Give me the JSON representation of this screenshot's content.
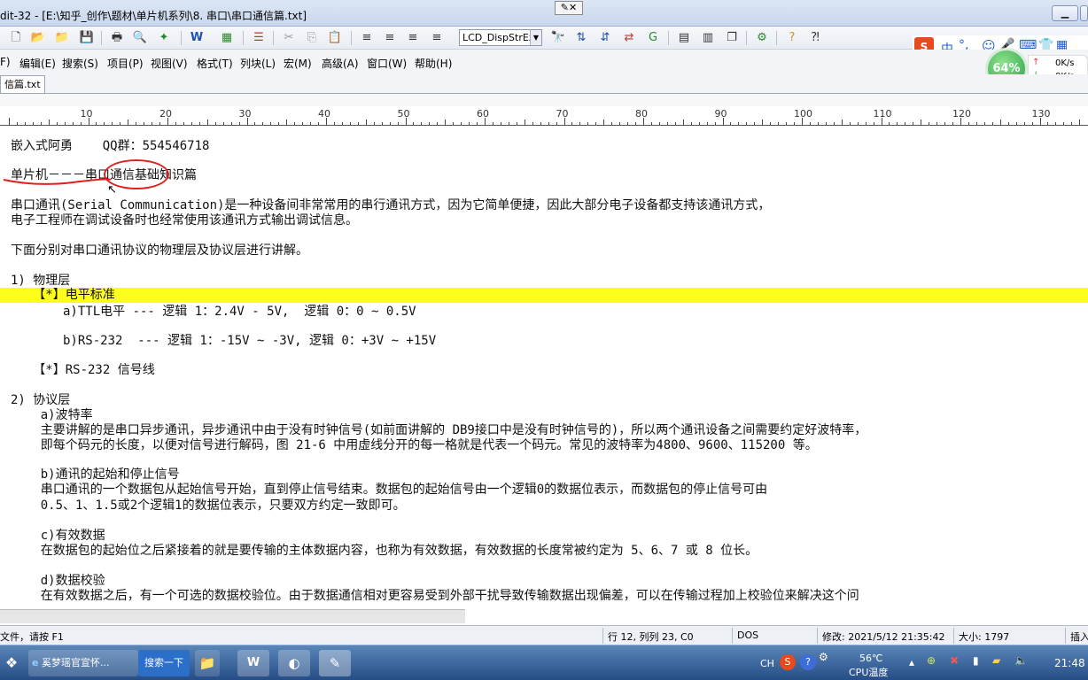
{
  "window": {
    "title": "dit-32 - [E:\\知乎_创作\\题材\\单片机系列\\8. 串口\\串口通信篇.txt]",
    "min": "▭",
    "max": "▭",
    "close": "✕",
    "mini_box": "✕"
  },
  "toolbar": {
    "font_combo": "LCD_DispStrEx"
  },
  "menu": [
    "F)",
    "编辑(E)",
    "搜索(S)",
    "项目(P)",
    "视图(V)",
    "格式(T)",
    "列块(L)",
    "宏(M)",
    "高级(A)",
    "窗口(W)",
    "帮助(H)"
  ],
  "tab": {
    "label": "信篇.txt"
  },
  "ruler": [
    "10",
    "20",
    "30",
    "40",
    "50",
    "60",
    "70",
    "80",
    "90",
    "100",
    "110",
    "120",
    "130"
  ],
  "editor": {
    "lines": [
      "嵌入式阿勇    QQ群：554546718",
      "单片机－－－串口通信基础知识篇",
      "串口通讯(Serial Communication)是一种设备间非常常用的串行通讯方式，因为它简单便捷，因此大部分电子设备都支持该通讯方式，",
      "电子工程师在调试设备时也经常使用该通讯方式输出调试信息。",
      "下面分别对串口通讯协议的物理层及协议层进行讲解。",
      "1) 物理层",
      "   【*】电平标准",
      "       a)TTL电平 --- 逻辑 1：2.4V - 5V,  逻辑 0：0 ~ 0.5V",
      "       b)RS-232  --- 逻辑 1：-15V ~ -3V, 逻辑 0：+3V ~ +15V",
      "   【*】RS-232 信号线",
      "2) 协议层",
      "    a)波特率",
      "    主要讲解的是串口异步通讯，异步通讯中由于没有时钟信号(如前面讲解的 DB9接口中是没有时钟信号的)，所以两个通讯设备之间需要约定好波特率，",
      "    即每个码元的长度，以便对信号进行解码，图 21-6 中用虚线分开的每一格就是代表一个码元。常见的波特率为4800、9600、115200 等。",
      "    b)通讯的起始和停止信号",
      "    串口通讯的一个数据包从起始信号开始，直到停止信号结束。数据包的起始信号由一个逻辑0的数据位表示，而数据包的停止信号可由",
      "    0.5、1、1.5或2个逻辑1的数据位表示，只要双方约定一致即可。",
      "    c)有效数据",
      "    在数据包的起始位之后紧接着的就是要传输的主体数据内容，也称为有效数据，有效数据的长度常被约定为 5、6、7 或 8 位长。",
      "    d)数据校验",
      "    在有效数据之后，有一个可选的数据校验位。由于数据通信相对更容易受到外部干扰导致传输数据出现偏差，可以在传输过程加上校验位来解决这个问"
    ]
  },
  "status": {
    "help": "文件，请按 F1",
    "pos": "行 12, 列列 23, C0",
    "eol": "DOS",
    "modified": "修改: 2021/5/12 21:35:42",
    "size": "大小: 1797",
    "mode": "插入"
  },
  "taskbar": {
    "item1": "奚梦瑶官宣怀...",
    "search": "搜索一下",
    "lang": "CH",
    "temp": "56℃",
    "temp_label": "CPU温度",
    "clock": "21:48"
  },
  "overlay": {
    "ime_zh": "中",
    "net_percent": "64%",
    "up": "0K/s",
    "down": "0K/s"
  }
}
